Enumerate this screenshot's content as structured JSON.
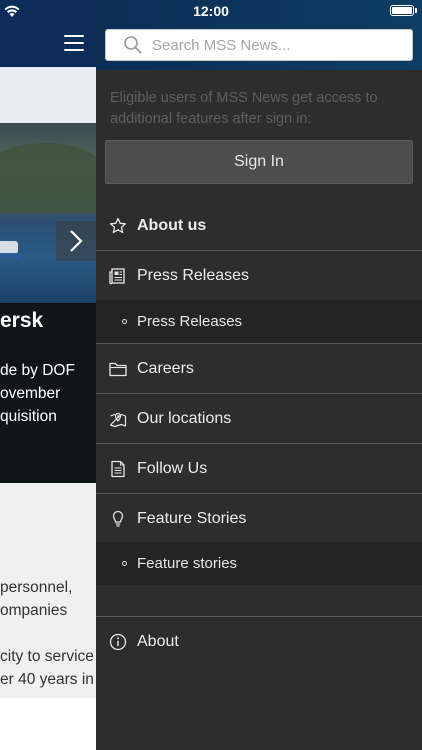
{
  "status_bar": {
    "time": "12:00"
  },
  "background_page": {
    "hero_title": "ersk",
    "hero_text_lines": [
      "de by DOF",
      "ovember",
      "quisition"
    ],
    "body_text_lines": [
      "personnel,",
      "ompanies",
      "",
      "city to service",
      "er 40 years in"
    ]
  },
  "drawer": {
    "search": {
      "placeholder": "Search MSS News...",
      "value": ""
    },
    "signin_note": "Eligible users of MSS News get access to additional features after sign in:",
    "signin_label": "Sign In",
    "menu": {
      "about_us": "About us",
      "press_releases": "Press Releases",
      "press_releases_sub": "Press Releases",
      "careers": "Careers",
      "our_locations": "Our locations",
      "follow_us": "Follow Us",
      "feature_stories": "Feature Stories",
      "feature_stories_sub": "Feature stories",
      "about": "About"
    }
  },
  "colors": {
    "header_navy": "#0b2d57",
    "drawer_bg": "#2d2d2d",
    "sub_item_bg": "#242424",
    "divider": "#585858",
    "button_bg": "#4d4d4d"
  },
  "icons": [
    "wifi-icon",
    "battery-icon",
    "hamburger-menu-icon",
    "chevron-right-icon",
    "search-icon",
    "star-icon",
    "newspaper-icon",
    "folder-icon",
    "map-pin-icon",
    "document-icon",
    "lightbulb-icon",
    "info-icon"
  ]
}
